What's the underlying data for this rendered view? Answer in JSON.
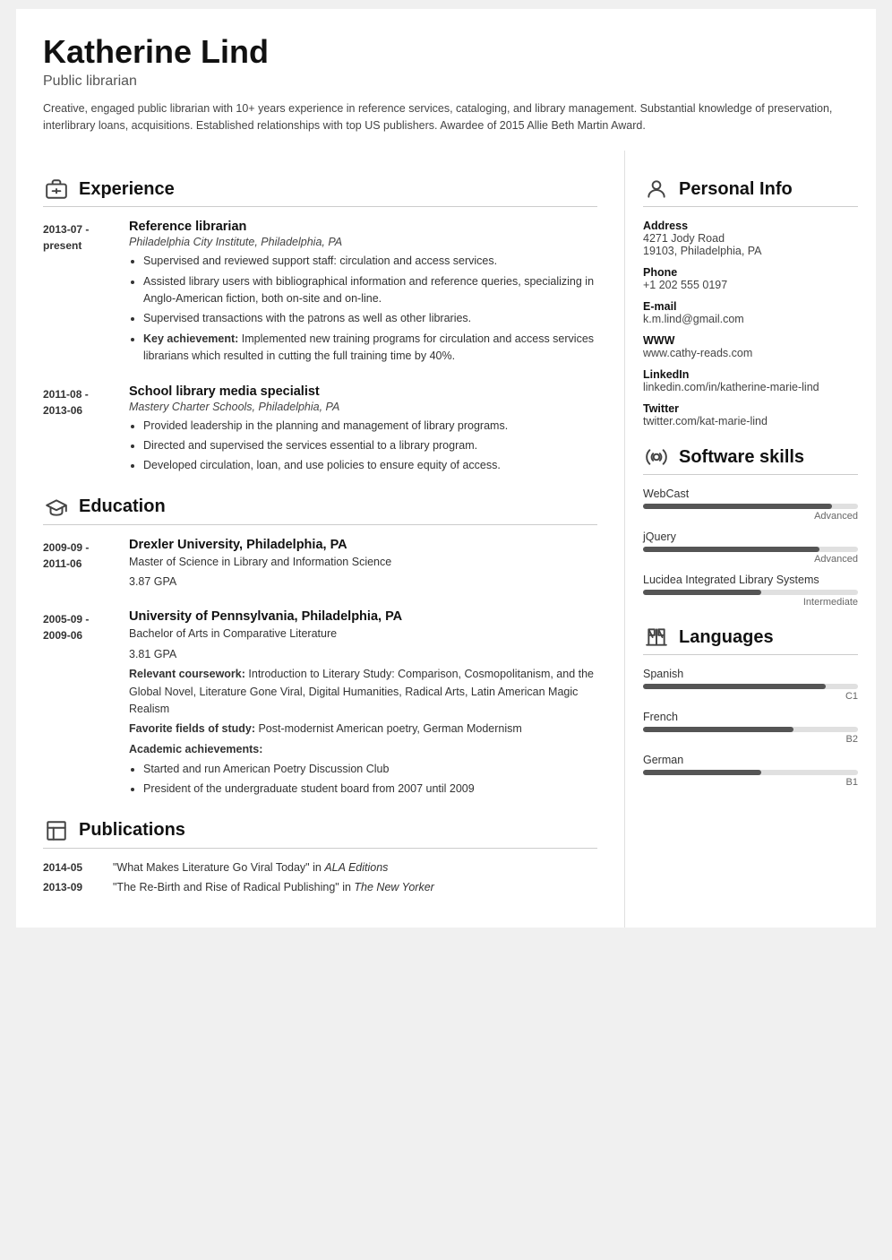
{
  "header": {
    "name": "Katherine Lind",
    "title": "Public librarian",
    "summary": "Creative, engaged public librarian with 10+ years experience in reference services, cataloging, and library management. Substantial knowledge of preservation, interlibrary loans, acquisitions. Established relationships with top US publishers. Awardee of 2015 Allie Beth Martin Award."
  },
  "experience": {
    "section_title": "Experience",
    "entries": [
      {
        "dates": "2013-07 -\npresent",
        "title": "Reference librarian",
        "institution": "Philadelphia City Institute, Philadelphia, PA",
        "bullets": [
          "Supervised and reviewed support staff: circulation and access services.",
          "Assisted library users with bibliographical information and reference queries, specializing in Anglo-American fiction, both on-site and on-line.",
          "Supervised transactions with the patrons as well as other libraries.",
          "Key achievement: Implemented new training programs for circulation and access services librarians which resulted in cutting the full training time by 40%."
        ],
        "key_bold": "Key achievement:"
      },
      {
        "dates": "2011-08 -\n2013-06",
        "title": "School library media specialist",
        "institution": "Mastery Charter Schools, Philadelphia, PA",
        "bullets": [
          "Provided leadership in the planning and management of library programs.",
          "Directed and supervised the services essential to a library program.",
          "Developed circulation, loan, and use policies to ensure equity of access."
        ]
      }
    ]
  },
  "education": {
    "section_title": "Education",
    "entries": [
      {
        "dates": "2009-09 -\n2011-06",
        "institution": "Drexler University, Philadelphia, PA",
        "degree": "Master of Science in Library and Information Science",
        "gpa": "3.87 GPA"
      },
      {
        "dates": "2005-09 -\n2009-06",
        "institution": "University of Pennsylvania, Philadelphia, PA",
        "degree": "Bachelor of Arts in Comparative Literature",
        "gpa": "3.81 GPA",
        "relevant_label": "Relevant coursework:",
        "relevant_text": "Introduction to Literary Study: Comparison, Cosmopolitanism, and the Global Novel, Literature Gone Viral, Digital Humanities, Radical Arts, Latin American Magic Realism",
        "favorite_label": "Favorite fields of study:",
        "favorite_text": "Post-modernist American poetry, German Modernism",
        "academic_label": "Academic achievements:",
        "academic_bullets": [
          "Started and run American Poetry Discussion Club",
          "President of the undergraduate student board from 2007 until 2009"
        ]
      }
    ]
  },
  "publications": {
    "section_title": "Publications",
    "entries": [
      {
        "date": "2014-05",
        "text": "\"What Makes Literature Go Viral Today\" in ",
        "journal": "ALA Editions"
      },
      {
        "date": "2013-09",
        "text": "\"The Re-Birth and Rise of Radical Publishing\" in ",
        "journal": "The New Yorker"
      }
    ]
  },
  "personal_info": {
    "section_title": "Personal Info",
    "address_label": "Address",
    "address_line1": "4271 Jody Road",
    "address_line2": "19103, Philadelphia, PA",
    "phone_label": "Phone",
    "phone": "+1 202 555 0197",
    "email_label": "E-mail",
    "email": "k.m.lind@gmail.com",
    "www_label": "WWW",
    "www": "www.cathy-reads.com",
    "linkedin_label": "LinkedIn",
    "linkedin": "linkedin.com/in/katherine-marie-lind",
    "twitter_label": "Twitter",
    "twitter": "twitter.com/kat-marie-lind"
  },
  "software_skills": {
    "section_title": "Software skills",
    "skills": [
      {
        "name": "WebCast",
        "level": "Advanced",
        "percent": 88
      },
      {
        "name": "jQuery",
        "level": "Advanced",
        "percent": 82
      },
      {
        "name": "Lucidea Integrated Library Systems",
        "level": "Intermediate",
        "percent": 55
      }
    ]
  },
  "languages": {
    "section_title": "Languages",
    "langs": [
      {
        "name": "Spanish",
        "level": "C1",
        "percent": 85
      },
      {
        "name": "French",
        "level": "B2",
        "percent": 70
      },
      {
        "name": "German",
        "level": "B1",
        "percent": 55
      }
    ]
  }
}
